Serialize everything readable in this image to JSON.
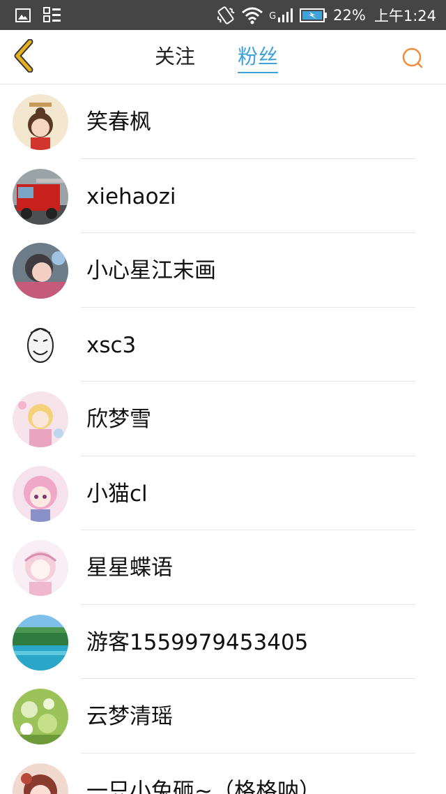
{
  "status_bar": {
    "battery_percent": "22%",
    "time": "上午1:24",
    "network_label": "G",
    "icons": [
      "gallery-icon",
      "apps-icon",
      "vibrate-icon",
      "wifi-icon",
      "signal-icon",
      "battery-icon"
    ]
  },
  "nav": {
    "tab_follow": "关注",
    "tab_fans": "粉丝",
    "active_tab": "粉丝",
    "accent_color": "#3fa2d8",
    "back_color": "#e6b020",
    "search_color": "#f08c3c"
  },
  "fans": [
    {
      "name": "笑春枫"
    },
    {
      "name": "xiehaozi"
    },
    {
      "name": "小心星江末画"
    },
    {
      "name": "xsc3"
    },
    {
      "name": "欣梦雪"
    },
    {
      "name": "小猫cl"
    },
    {
      "name": "星星蝶语"
    },
    {
      "name": "游客1559979453405"
    },
    {
      "name": "云梦清瑶"
    },
    {
      "name": "一只小兔砸~（格格呐）"
    }
  ]
}
